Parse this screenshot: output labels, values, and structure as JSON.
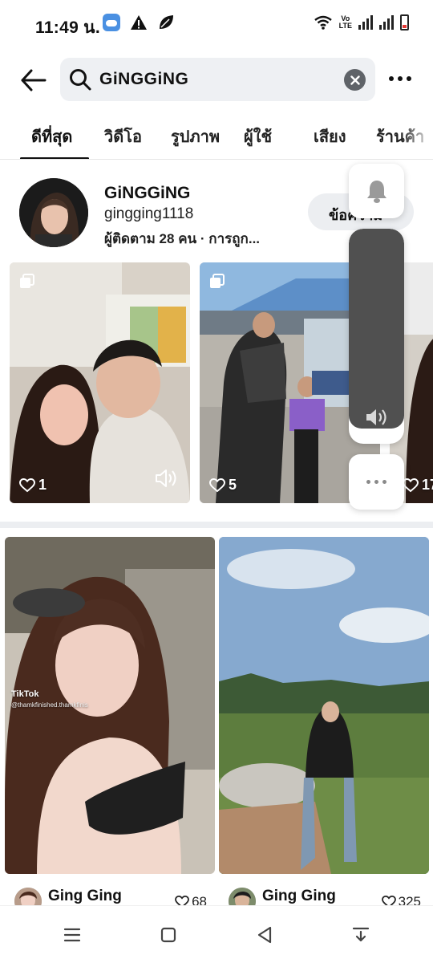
{
  "status_bar": {
    "time": "11:49 น.",
    "network_label_top": "Vo",
    "network_label_bottom": "LTE",
    "icons": [
      "weather-icon",
      "alert-icon",
      "leaf-icon",
      "wifi-icon",
      "volte-icon",
      "signal-icon",
      "signal-icon",
      "battery-icon"
    ]
  },
  "search": {
    "query": "GiNGGiNG",
    "back_icon": "arrow-left-icon",
    "clear_icon": "close-circle-icon",
    "more_icon": "more-horizontal-icon"
  },
  "tabs": [
    {
      "label": "ดีที่สุด",
      "active": true
    },
    {
      "label": "วิดีโอ",
      "active": false
    },
    {
      "label": "รูปภาพ",
      "active": false
    },
    {
      "label": "ผู้ใช้",
      "active": false
    },
    {
      "label": "เสียง",
      "active": false
    },
    {
      "label": "ร้านค้า",
      "active": false
    }
  ],
  "profile": {
    "name": "GiNGGiNG",
    "handle": "gingging1118",
    "meta": "ผู้ติดตาม 28 คน · การถูก...",
    "button_label": "ข้อความ"
  },
  "videos": [
    {
      "likes": "1",
      "has_sound_icon": true
    },
    {
      "likes": "5",
      "has_sound_icon": false
    },
    {
      "likes": "17",
      "has_sound_icon": false
    }
  ],
  "feed": [
    {
      "author": "Ging Ging",
      "likes": "68",
      "watermark": "TikTok",
      "watermark_sub": "@thamkfinished.thamkfinis"
    },
    {
      "author": "Ging Ging",
      "likes": "325"
    }
  ],
  "floating_controls": {
    "bell_icon": "bell-icon",
    "volume_icon": "volume-icon",
    "volume_level": 0.93,
    "more_icon": "more-horizontal-icon"
  },
  "nav_bar": [
    "menu-icon",
    "home-square-icon",
    "back-triangle-icon",
    "download-icon"
  ],
  "colors": {
    "search_bg": "#eef0f3",
    "text": "#111111",
    "divider": "#eceef1",
    "volume_fill": "#505050"
  }
}
